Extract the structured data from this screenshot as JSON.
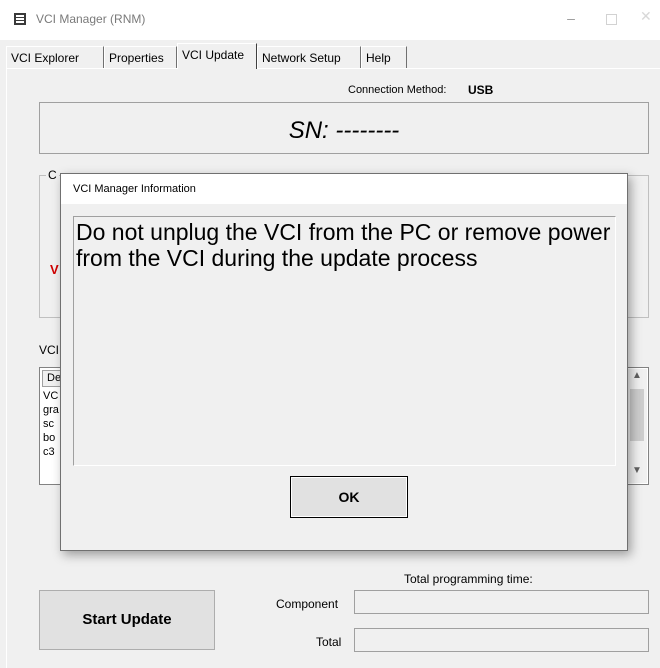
{
  "window": {
    "title": "VCI Manager (RNM)",
    "minimize_glyph": "–",
    "close_glyph": "✕"
  },
  "tabs": [
    {
      "label": "VCI Explorer"
    },
    {
      "label": "Properties"
    },
    {
      "label": "VCI Update",
      "selected": true
    },
    {
      "label": "Network Setup"
    },
    {
      "label": "Help"
    }
  ],
  "connection": {
    "label": "Connection Method:",
    "value": "USB"
  },
  "serial": {
    "label": "SN: --------"
  },
  "group": {
    "title": "C"
  },
  "status": {
    "red_text": "V"
  },
  "vci_list": {
    "label": "VCI",
    "header": "De",
    "items": [
      "VC",
      "gra",
      "sc",
      "bo",
      "c3"
    ]
  },
  "dialog": {
    "title": "VCI Manager Information",
    "message": "Do not unplug the VCI from the PC or remove power from the VCI during the update process",
    "ok_label": "OK"
  },
  "footer": {
    "total_time_label": "Total programming time:",
    "start_label": "Start Update",
    "component_label": "Component",
    "component_value": "",
    "total_label": "Total",
    "total_value": ""
  },
  "colors": {
    "warning_red": "#d00000",
    "background": "#f0f0f0"
  }
}
